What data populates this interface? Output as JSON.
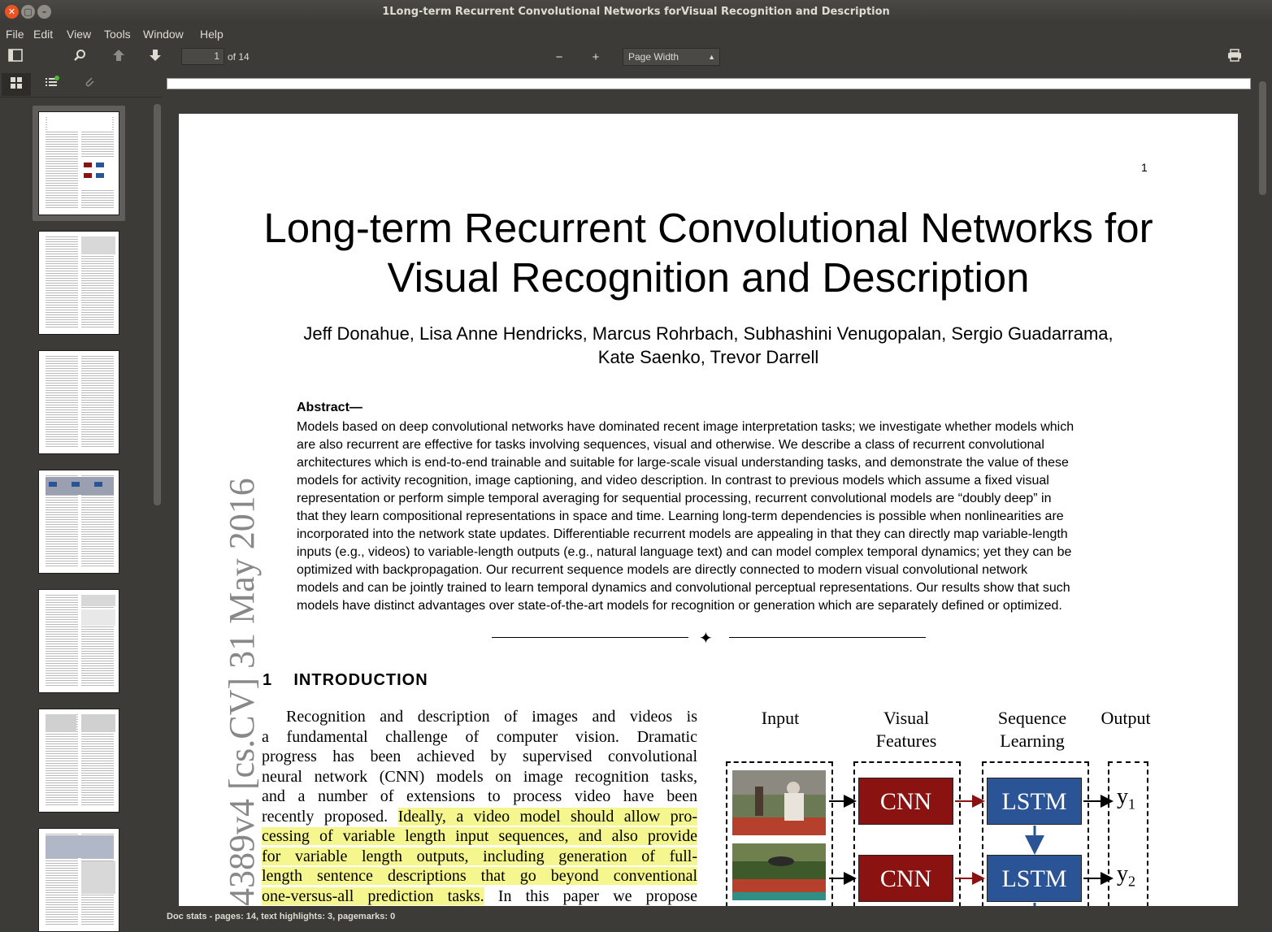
{
  "window": {
    "title": "1Long-term Recurrent Convolutional Networks forVisual Recognition and Description"
  },
  "menu": [
    "File",
    "Edit",
    "View",
    "Tools",
    "Window",
    "Help"
  ],
  "toolbar": {
    "page_current": "1",
    "page_total": "of 14",
    "zoom_label": "Page Width"
  },
  "page": {
    "number": "1",
    "title_lines": [
      "Long-term Recurrent Convolutional Networks for",
      "Visual Recognition and Description"
    ],
    "author_lines": [
      "Jeff Donahue, Lisa Anne Hendricks, Marcus Rohrbach, Subhashini Venugopalan, Sergio Guadarrama,",
      "Kate Saenko, Trevor Darrell"
    ],
    "abstract_head": "Abstract—",
    "abstract_lines": [
      "Models based on deep convolutional networks have dominated recent image interpretation tasks; we investigate whether models which",
      "are also recurrent are effective for tasks involving sequences, visual and otherwise. We describe a class of recurrent convolutional",
      "architectures which is end-to-end trainable and suitable for large-scale visual understanding tasks, and demonstrate the value of these",
      "models for activity recognition, image captioning, and video description. In contrast to previous models which assume a fixed visual",
      "representation or perform simple temporal averaging for sequential processing, recurrent convolutional models are “doubly deep” in",
      "that they learn compositional representations in space and time. Learning long-term dependencies is possible when nonlinearities are",
      "incorporated into the network state updates. Differentiable recurrent models are appealing in that they can directly map variable-length",
      "inputs (e.g., videos) to variable-length outputs (e.g., natural language text) and can model complex temporal dynamics; yet they can be",
      "optimized with backpropagation. Our recurrent sequence models are directly connected to modern visual convolutional network",
      "models and can be jointly trained to learn temporal dynamics and convolutional perceptual representations. Our results show that such",
      "models have distinct advantages over state-of-the-art models for recognition or generation which are separately defined or optimized."
    ],
    "section_num": "1",
    "section_title": "INTRODUCTION",
    "intro_lines": [
      {
        "pre": "Recognition and description of images and videos is",
        "hl": "",
        "post": ""
      },
      {
        "pre": "a fundamental challenge of computer vision. Dramatic",
        "hl": "",
        "post": ""
      },
      {
        "pre": "progress has been achieved by supervised convolutional",
        "hl": "",
        "post": ""
      },
      {
        "pre": "neural network (CNN) models on image recognition tasks,",
        "hl": "",
        "post": ""
      },
      {
        "pre": "and a number of extensions to process video have been",
        "hl": "",
        "post": ""
      },
      {
        "pre": "recently proposed. ",
        "hl": "Ideally, a video model should allow pro-",
        "post": ""
      },
      {
        "pre": "",
        "hl": "cessing of variable length input sequences, and also provide",
        "post": ""
      },
      {
        "pre": "",
        "hl": "for variable length outputs, including generation of full-",
        "post": ""
      },
      {
        "pre": "",
        "hl": "length sentence descriptions that go beyond conventional",
        "post": ""
      },
      {
        "pre": "",
        "hl": "one-versus-all prediction tasks.",
        "post": " In this paper we propose"
      }
    ],
    "arxiv_stamp": "4389v4  [cs.CV]  31 May 2016",
    "figure": {
      "col_input": "Input",
      "col_visual": [
        "Visual",
        "Features"
      ],
      "col_seq": [
        "Sequence",
        "Learning"
      ],
      "col_output": "Output",
      "cnn_label": "CNN",
      "lstm_label": "LSTM",
      "y_labels": [
        "y",
        "y"
      ],
      "y_subs": [
        "1",
        "2"
      ],
      "colors": {
        "cnn": "#8a1211",
        "lstm": "#2b5496",
        "arrow_red": "#8a1211"
      }
    }
  },
  "status": "Doc stats - pages: 14, text highlights: 3, pagemarks: 0"
}
